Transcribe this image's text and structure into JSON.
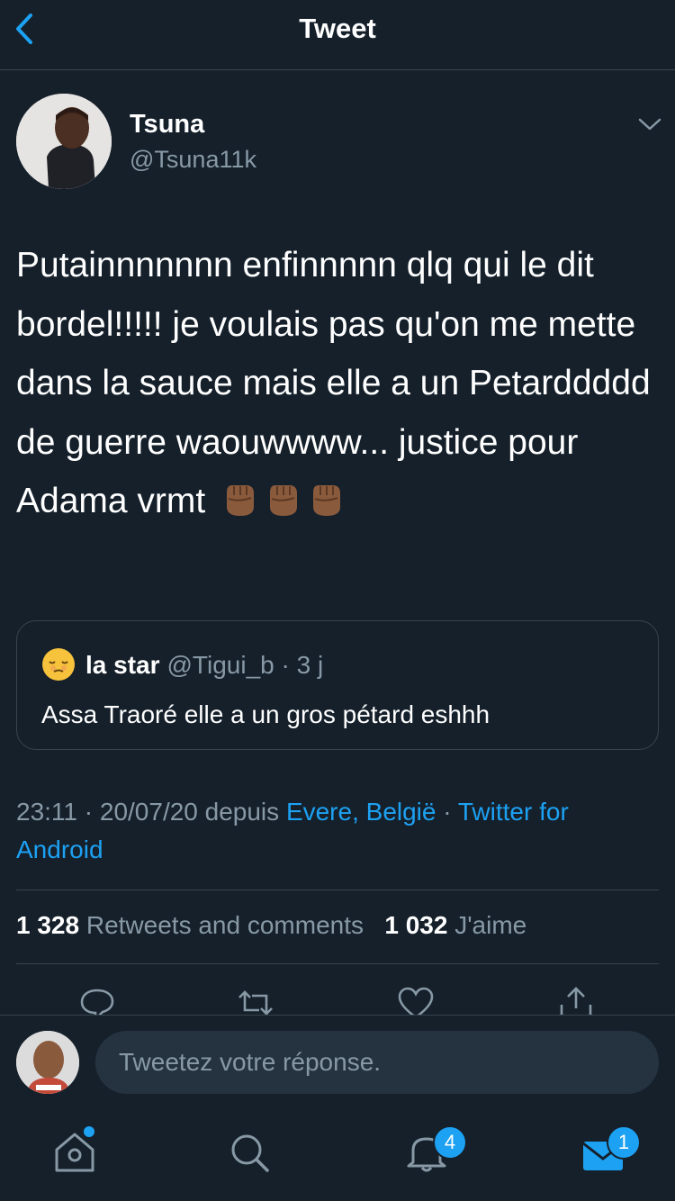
{
  "header": {
    "title": "Tweet",
    "back_icon": "chevron-left-icon"
  },
  "tweet": {
    "author_name": "Tsuna",
    "author_handle": "@Tsuna11k",
    "text": "Putainnnnnnn enfinnnnn qlq qui le dit bordel!!!!! je voulais pas qu'on me mette dans la sauce mais elle a un Petarddddd de guerre waouwwww... justice pour Adama vrmt",
    "emojis": [
      "raised-fist-icon",
      "raised-fist-icon",
      "raised-fist-icon"
    ],
    "timestamp": "23:11 · 20/07/20 depuis",
    "location": "Evere, België",
    "separator": "·",
    "source": "Twitter for Android"
  },
  "quote": {
    "emoji": "relieved-face-icon",
    "name": "la star",
    "handle": "@Tigui_b · 3 j",
    "text": "Assa Traoré elle a un gros pétard eshhh"
  },
  "stats": {
    "retweets_count": "1 328",
    "retweets_label": "Retweets and comments",
    "likes_count": "1 032",
    "likes_label": "J'aime"
  },
  "actions": [
    "reply-icon",
    "retweet-icon",
    "like-icon",
    "share-icon"
  ],
  "reply": {
    "placeholder": "Tweetez votre réponse."
  },
  "tabbar": {
    "home_icon": "home-icon",
    "search_icon": "search-icon",
    "notifications_icon": "bell-icon",
    "notifications_badge": "4",
    "messages_icon": "mail-icon",
    "messages_badge": "1"
  },
  "colors": {
    "background": "#15202b",
    "accent": "#1da1f2",
    "muted": "#8899a6",
    "border": "#38444d"
  }
}
